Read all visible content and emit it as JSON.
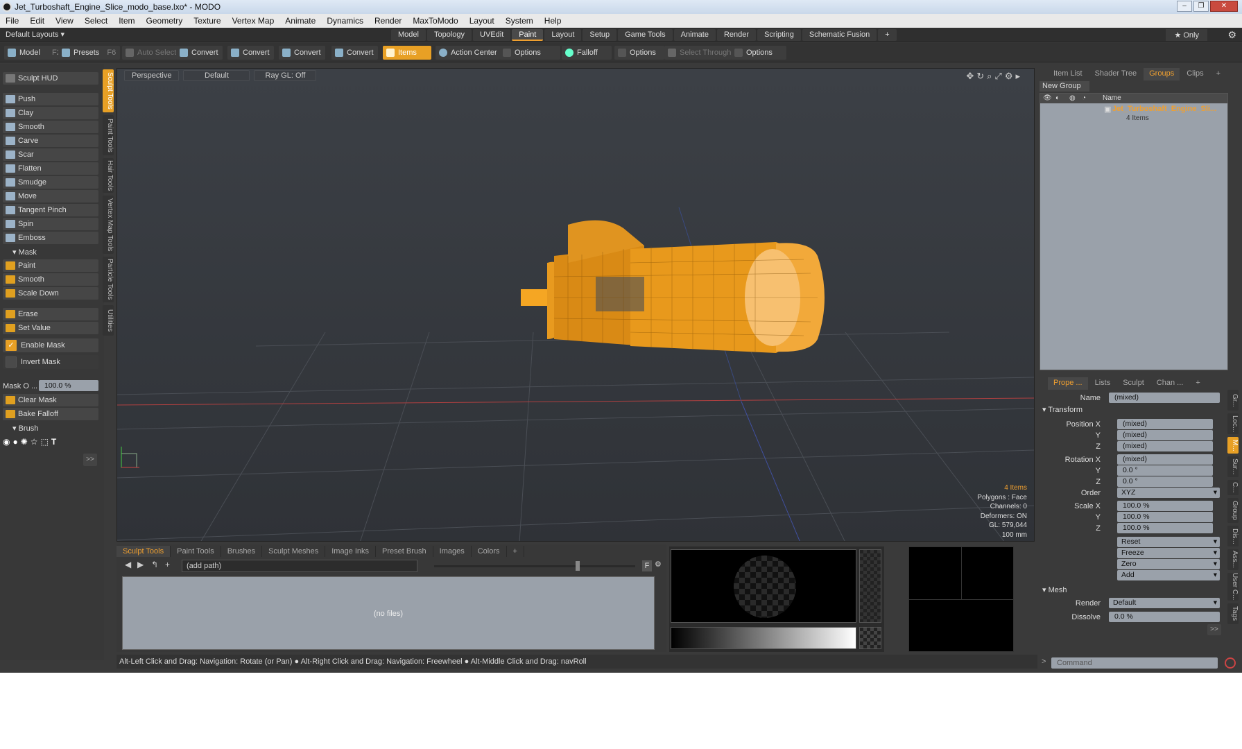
{
  "window": {
    "title": "Jet_Turboshaft_Engine_Slice_modo_base.lxo* - MODO"
  },
  "menu": [
    "File",
    "Edit",
    "View",
    "Select",
    "Item",
    "Geometry",
    "Texture",
    "Vertex Map",
    "Animate",
    "Dynamics",
    "Render",
    "MaxToModo",
    "Layout",
    "System",
    "Help"
  ],
  "layout": {
    "selector": "Default Layouts ▾",
    "only": "★ Only"
  },
  "layout_tabs": [
    "Model",
    "Topology",
    "UVEdit",
    "Paint",
    "Layout",
    "Setup",
    "Game Tools",
    "Animate",
    "Render",
    "Scripting",
    "Schematic Fusion",
    "+"
  ],
  "active_layout_tab": "Paint",
  "toolbar": {
    "model": "Model",
    "model_key": "F2",
    "presets": "Presets",
    "presets_key": "F6",
    "auto_select": "Auto Select",
    "convert1": "Convert",
    "convert2": "Convert",
    "convert3": "Convert",
    "convert4": "Convert",
    "items": "Items",
    "action_center": "Action Center",
    "options1": "Options",
    "falloff": "Falloff",
    "options2": "Options",
    "select_through": "Select Through",
    "options3": "Options"
  },
  "sidebar": {
    "hud": "Sculpt HUD",
    "tools": [
      "Push",
      "Clay",
      "Smooth",
      "Carve",
      "Scar",
      "Flatten",
      "Smudge",
      "Move",
      "Tangent Pinch",
      "Spin",
      "Emboss"
    ],
    "mask_section": "Mask",
    "mask_tools": [
      "Paint",
      "Smooth",
      "Scale Down"
    ],
    "erase": "Erase",
    "set_value": "Set Value",
    "enable_mask": "Enable Mask",
    "invert_mask": "Invert Mask",
    "mask_opacity_label": "Mask O ...",
    "mask_opacity_value": "100.0 %",
    "clear_mask": "Clear Mask",
    "bake_falloff": "Bake Falloff",
    "brush_section": "Brush",
    "more": ">>"
  },
  "vertical_tabs": [
    "Sculpt Tools",
    "Paint Tools",
    "Hair Tools",
    "Vertex Map Tools",
    "Particle Tools",
    "Utilities"
  ],
  "viewport": {
    "view": "Perspective",
    "shading": "Default",
    "raygl": "Ray GL: Off",
    "stats": {
      "items": "4 Items",
      "polygons": "Polygons : Face",
      "channels": "Channels: 0",
      "deformers": "Deformers: ON",
      "gl": "GL: 579,044",
      "scale": "100 mm"
    }
  },
  "bottom_tabs": [
    "Sculpt Tools",
    "Paint Tools",
    "Brushes",
    "Sculpt Meshes",
    "Image Inks",
    "Preset Brush",
    "Images",
    "Colors",
    "+"
  ],
  "bottom": {
    "path": "(add path)",
    "empty": "(no files)",
    "f_btn": "F"
  },
  "right_tabs": [
    "Item List",
    "Shader Tree",
    "Groups",
    "Clips",
    "+"
  ],
  "groups": {
    "new_group": "New Group",
    "name_header": "Name",
    "item_name": "Jet_Turboshaft_Engine_Sli...",
    "item_count": "4 Items"
  },
  "props_tabs": [
    "Prope ...",
    "Lists",
    "Sculpt",
    "Chan ...",
    "+"
  ],
  "props": {
    "name_label": "Name",
    "name_value": "(mixed)",
    "transform": "Transform",
    "pos_x_label": "Position X",
    "pos_x": "(mixed)",
    "pos_y_label": "Y",
    "pos_y": "(mixed)",
    "pos_z_label": "Z",
    "pos_z": "(mixed)",
    "rot_x_label": "Rotation X",
    "rot_x": "(mixed)",
    "rot_y_label": "Y",
    "rot_y": "0.0 °",
    "rot_z_label": "Z",
    "rot_z": "0.0 °",
    "order_label": "Order",
    "order": "XYZ",
    "scale_x_label": "Scale X",
    "scale_x": "100.0 %",
    "scale_y_label": "Y",
    "scale_y": "100.0 %",
    "scale_z_label": "Z",
    "scale_z": "100.0 %",
    "reset": "Reset",
    "freeze": "Freeze",
    "zero": "Zero",
    "add": "Add",
    "mesh": "Mesh",
    "render_label": "Render",
    "render": "Default",
    "dissolve_label": "Dissolve",
    "dissolve": "0.0 %",
    "more": ">>"
  },
  "props_side_tabs": [
    "Gr...",
    "Loc...",
    "M...",
    "Sur...",
    "C...",
    "Group",
    "Dis...",
    "Ass...",
    "User C...",
    "Tags"
  ],
  "statusbar": "Alt-Left Click and Drag: Navigation: Rotate (or Pan) ● Alt-Right Click and Drag: Navigation: Freewheel ● Alt-Middle Click and Drag: navRoll",
  "command_placeholder": "Command",
  "colors": {
    "accent": "#f0a030",
    "mesh": "#f5a623"
  }
}
